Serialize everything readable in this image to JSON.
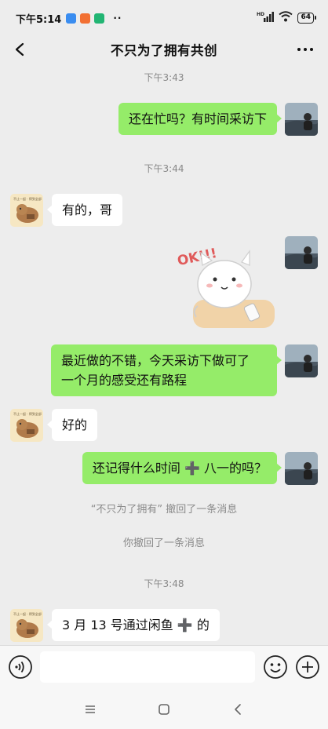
{
  "status_bar": {
    "time": "下午5:14",
    "dots": "··",
    "network": "HD",
    "battery": "64"
  },
  "header": {
    "title": "不只为了拥有共创",
    "back_icon": "chevron-left-icon",
    "more_icon": "more-dots-icon"
  },
  "messages": {
    "ts1": "下午3:43",
    "m1": "还在忙吗？有时间采访下",
    "ts2": "下午3:44",
    "m2": "有的，哥",
    "sticker_text": "OK!!!",
    "m4_line1": "最近做的不错，今天采访下做可了",
    "m4_line2": "一个月的感受还有路程",
    "m5": "好的",
    "m6": "还记得什么时间 ➕ 八一的吗？",
    "recall1": "“不只为了拥有” 撤回了一条消息",
    "recall2": "你撤回了一条消息",
    "ts3": "下午3:48",
    "m7": "3 月 13 号通过闲鱼 ➕ 的"
  },
  "avatars": {
    "other_caption": "不止一起 · 得到全部"
  },
  "input_bar": {
    "placeholder": "",
    "voice_icon": "voice-icon",
    "emoji_icon": "emoji-icon",
    "plus_icon": "plus-circle-icon"
  },
  "nav": {
    "menu_icon": "menu-icon",
    "home_icon": "home-square-icon",
    "back_icon": "back-triangle-icon"
  },
  "colors": {
    "background": "#ededed",
    "my_bubble": "#95ec69",
    "other_bubble": "#ffffff"
  }
}
